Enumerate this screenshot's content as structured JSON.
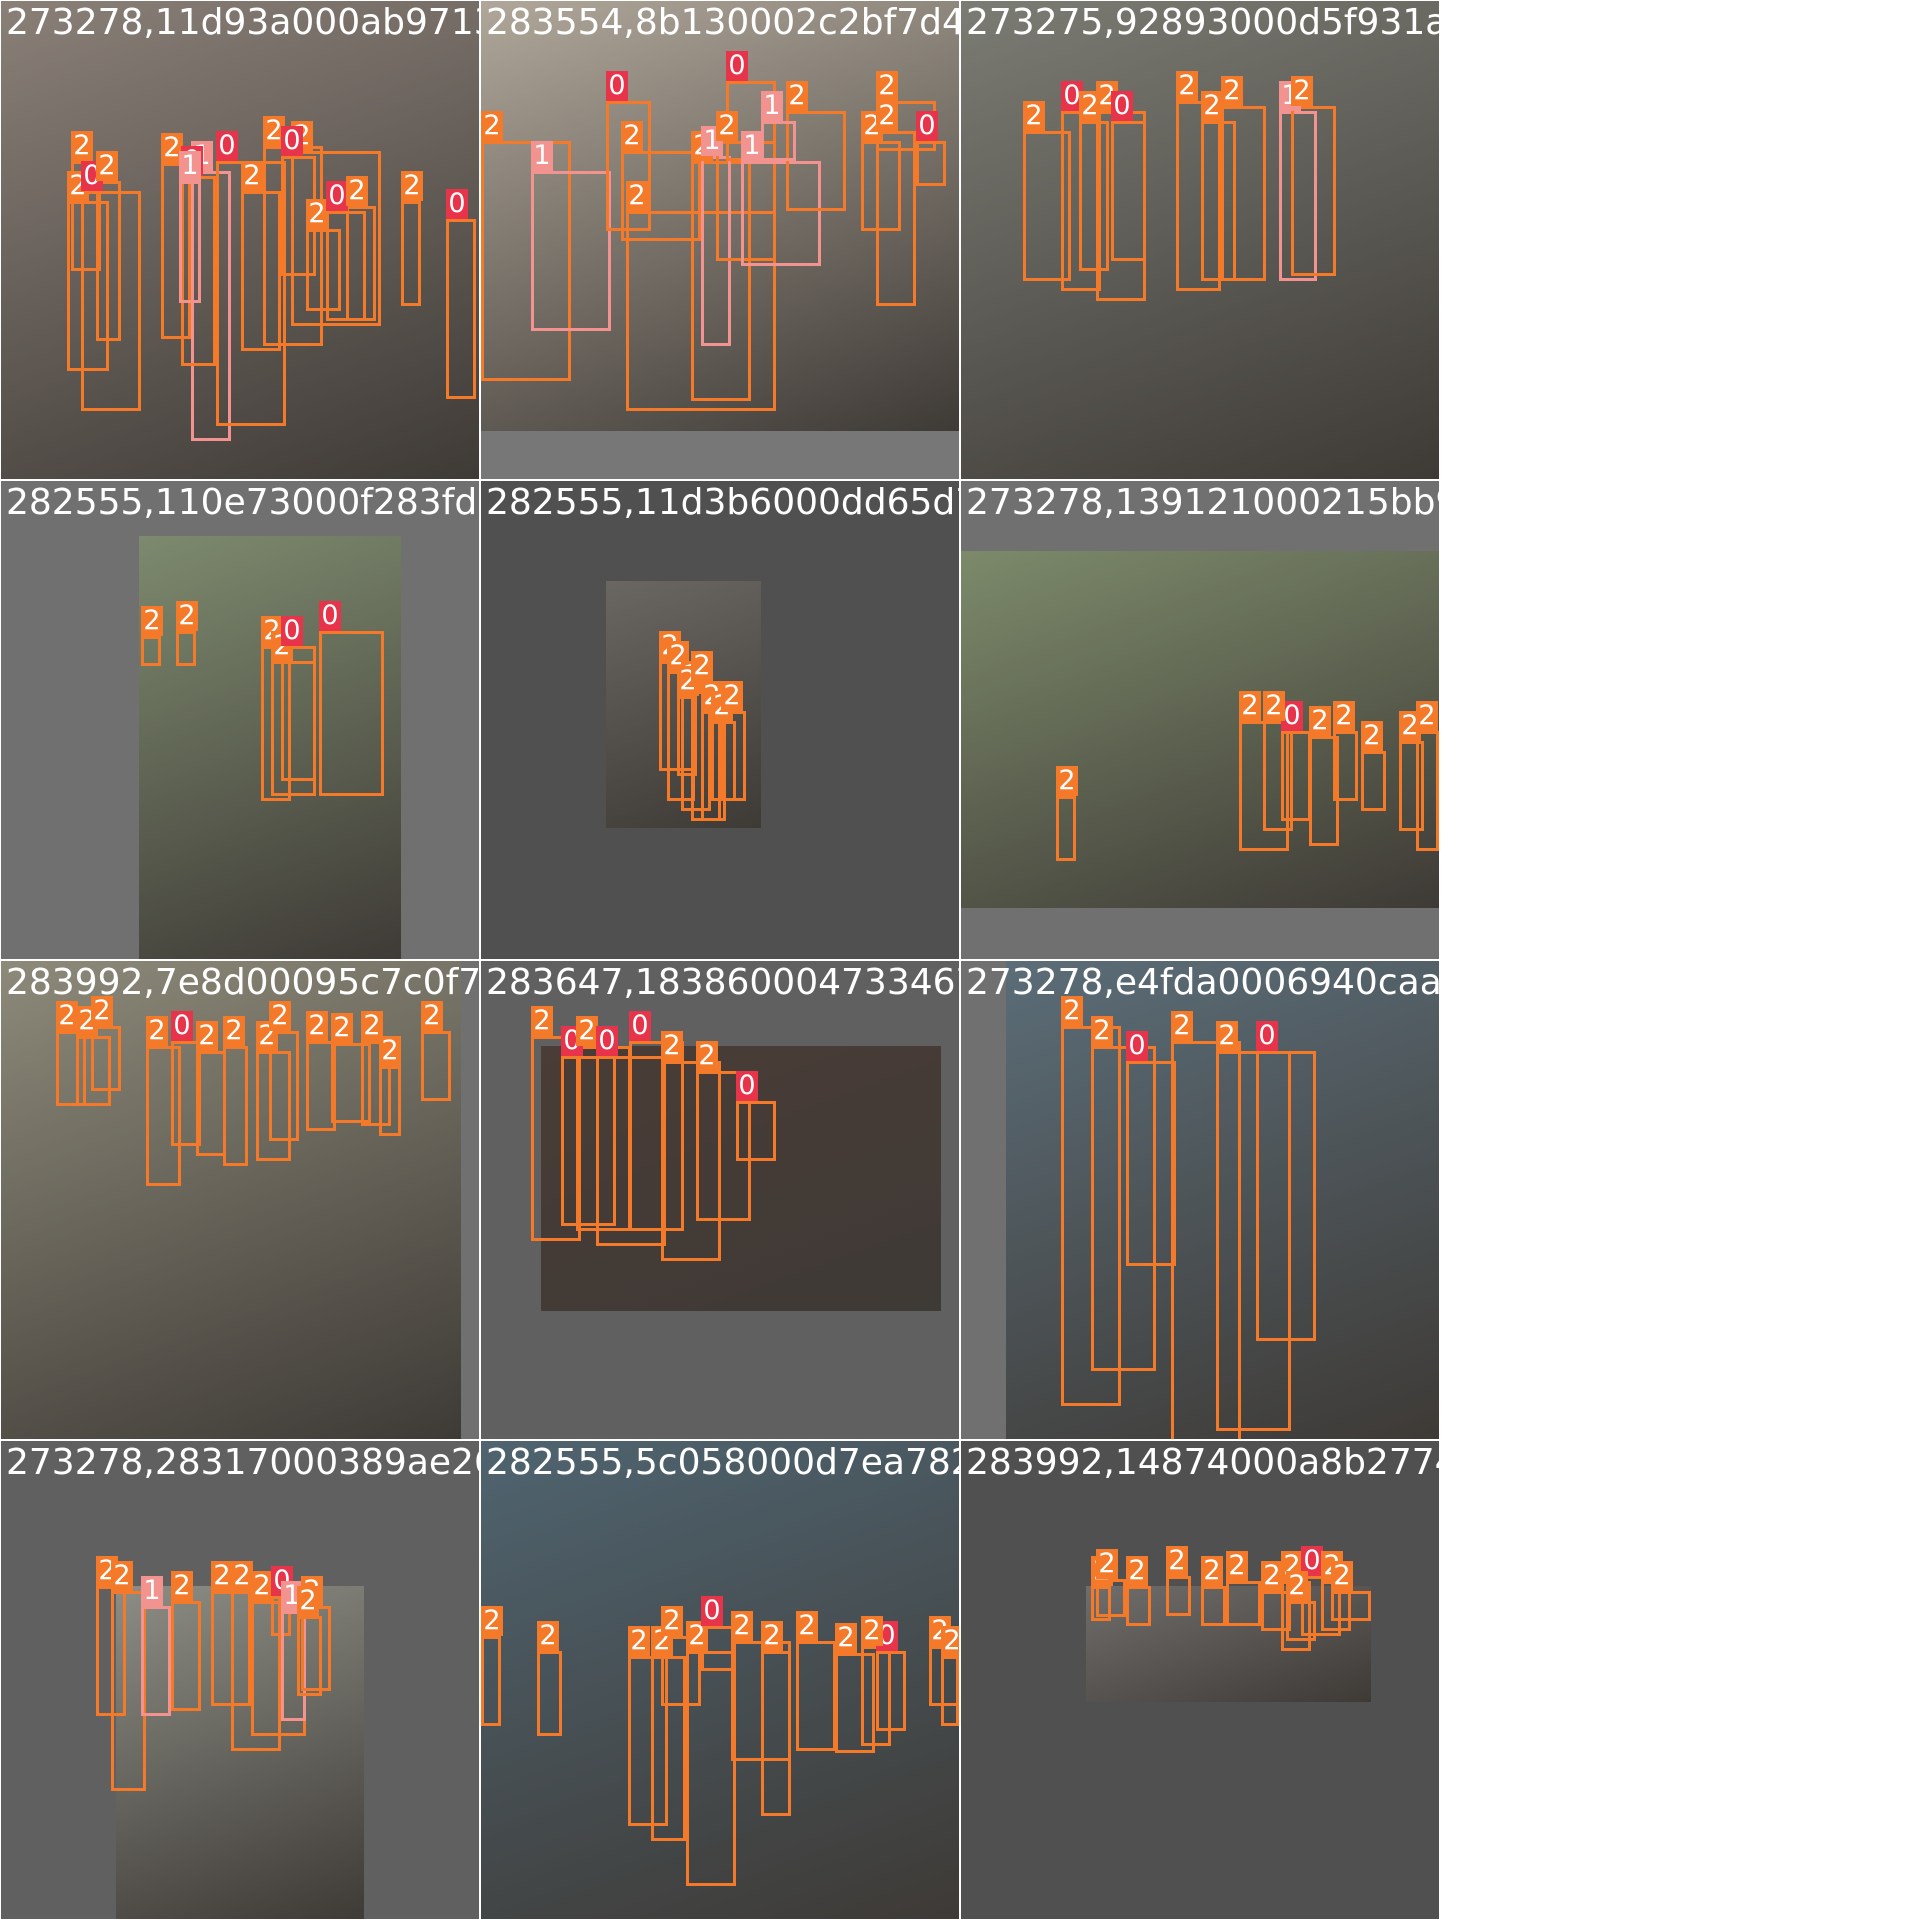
{
  "tiles": [
    {
      "filename": "273278,11d93a000ab97130.jpg",
      "photo_color": "#8a8078",
      "boxes": [
        {
          "c": "2",
          "label": "2"
        },
        {
          "c": "0",
          "label": "0"
        },
        {
          "c": "2",
          "label": "2"
        },
        {
          "c": "1",
          "label": "1"
        },
        {
          "c": "2",
          "label": "2"
        },
        {
          "c": "0",
          "label": "0"
        },
        {
          "c": "1",
          "label": "1"
        },
        {
          "c": "0",
          "label": "0"
        },
        {
          "c": "2",
          "label": "2"
        },
        {
          "c": "2",
          "label": "2"
        },
        {
          "c": "0",
          "label": "0"
        },
        {
          "c": "2",
          "label": "2"
        },
        {
          "c": "2",
          "label": "2"
        },
        {
          "c": "0",
          "label": "0"
        },
        {
          "c": "2",
          "label": "2"
        },
        {
          "c": "2",
          "label": "2"
        },
        {
          "c": "0",
          "label": "0"
        },
        {
          "c": "2",
          "label": "2"
        }
      ]
    },
    {
      "filename": "283554,8b130002c2bf7d4.jpg",
      "photo_color": "#b0a79a",
      "boxes": [
        {
          "c": "2",
          "label": "2"
        },
        {
          "c": "1",
          "label": "1"
        },
        {
          "c": "2",
          "label": "2"
        },
        {
          "c": "2",
          "label": "2"
        },
        {
          "c": "2",
          "label": "2"
        },
        {
          "c": "0",
          "label": "0"
        },
        {
          "c": "1",
          "label": "1"
        },
        {
          "c": "2",
          "label": "2"
        },
        {
          "c": "0",
          "label": "0"
        },
        {
          "c": "1",
          "label": "1"
        },
        {
          "c": "2",
          "label": "2"
        },
        {
          "c": "1",
          "label": "1"
        },
        {
          "c": "2",
          "label": "2"
        },
        {
          "c": "2",
          "label": "2"
        },
        {
          "c": "0",
          "label": "0"
        },
        {
          "c": "2",
          "label": "2"
        }
      ]
    },
    {
      "filename": "273275,92893000d5f931ab.jpg",
      "photo_color": "#7b7c74",
      "boxes": [
        {
          "c": "2",
          "label": "2"
        },
        {
          "c": "0",
          "label": "0"
        },
        {
          "c": "2",
          "label": "2"
        },
        {
          "c": "2",
          "label": "2"
        },
        {
          "c": "0",
          "label": "0"
        },
        {
          "c": "2",
          "label": "2"
        },
        {
          "c": "2",
          "label": "2"
        },
        {
          "c": "2",
          "label": "2"
        },
        {
          "c": "1",
          "label": "1"
        },
        {
          "c": "2",
          "label": "2"
        }
      ]
    },
    {
      "filename": "282555,110e73000f283fd7f.jpg",
      "photo_color": "#7d8a6e",
      "boxes": [
        {
          "c": "2",
          "label": "2"
        },
        {
          "c": "2",
          "label": "2"
        },
        {
          "c": "2",
          "label": "2"
        },
        {
          "c": "2",
          "label": "2"
        },
        {
          "c": "0",
          "label": "0"
        },
        {
          "c": "0",
          "label": "0"
        }
      ]
    },
    {
      "filename": "282555,11d3b6000dd65d7b6.jpg",
      "photo_color": "#6a6662",
      "boxes": [
        {
          "c": "2",
          "label": "2"
        },
        {
          "c": "2",
          "label": "2"
        },
        {
          "c": "2",
          "label": "2"
        },
        {
          "c": "2",
          "label": "2"
        },
        {
          "c": "2",
          "label": "2"
        },
        {
          "c": "2",
          "label": "2"
        },
        {
          "c": "2",
          "label": "2"
        },
        {
          "c": "2",
          "label": "2"
        }
      ]
    },
    {
      "filename": "273278,139121000215bb918.jpg",
      "photo_color": "#7c8a6a",
      "boxes": [
        {
          "c": "2",
          "label": "2"
        },
        {
          "c": "2",
          "label": "2"
        },
        {
          "c": "0",
          "label": "0"
        },
        {
          "c": "2",
          "label": "2"
        },
        {
          "c": "2",
          "label": "2"
        },
        {
          "c": "2",
          "label": "2"
        },
        {
          "c": "2",
          "label": "2"
        },
        {
          "c": "2",
          "label": "2"
        },
        {
          "c": "2",
          "label": "2"
        }
      ]
    },
    {
      "filename": "283992,7e8d00095c7c0f7.jpg",
      "photo_color": "#8d8a7a",
      "boxes": [
        {
          "c": "2",
          "label": "2"
        },
        {
          "c": "2",
          "label": "2"
        },
        {
          "c": "2",
          "label": "2"
        },
        {
          "c": "2",
          "label": "2"
        },
        {
          "c": "0",
          "label": "0"
        },
        {
          "c": "2",
          "label": "2"
        },
        {
          "c": "2",
          "label": "2"
        },
        {
          "c": "2",
          "label": "2"
        },
        {
          "c": "2",
          "label": "2"
        },
        {
          "c": "2",
          "label": "2"
        },
        {
          "c": "2",
          "label": "2"
        },
        {
          "c": "2",
          "label": "2"
        },
        {
          "c": "2",
          "label": "2"
        },
        {
          "c": "2",
          "label": "2"
        }
      ]
    },
    {
      "filename": "283647,1838600047334670.jpg",
      "photo_color": "#4a3c36",
      "boxes": [
        {
          "c": "2",
          "label": "2"
        },
        {
          "c": "0",
          "label": "0"
        },
        {
          "c": "2",
          "label": "2"
        },
        {
          "c": "0",
          "label": "0"
        },
        {
          "c": "0",
          "label": "0"
        },
        {
          "c": "2",
          "label": "2"
        },
        {
          "c": "2",
          "label": "2"
        },
        {
          "c": "0",
          "label": "0"
        }
      ]
    },
    {
      "filename": "273278,e4fda0006940caaf.jpg",
      "photo_color": "#5b6d78",
      "boxes": [
        {
          "c": "2",
          "label": "2"
        },
        {
          "c": "2",
          "label": "2"
        },
        {
          "c": "0",
          "label": "0"
        },
        {
          "c": "2",
          "label": "2"
        },
        {
          "c": "2",
          "label": "2"
        },
        {
          "c": "0",
          "label": "0"
        }
      ]
    },
    {
      "filename": "273278,28317000389ae26d.jpg",
      "photo_color": "#8c8d84",
      "boxes": [
        {
          "c": "2",
          "label": "2"
        },
        {
          "c": "2",
          "label": "2"
        },
        {
          "c": "1",
          "label": "1"
        },
        {
          "c": "2",
          "label": "2"
        },
        {
          "c": "2",
          "label": "2"
        },
        {
          "c": "2",
          "label": "2"
        },
        {
          "c": "2",
          "label": "2"
        },
        {
          "c": "0",
          "label": "0"
        },
        {
          "c": "1",
          "label": "1"
        },
        {
          "c": "2",
          "label": "2"
        },
        {
          "c": "2",
          "label": "2"
        }
      ]
    },
    {
      "filename": "282555,5c058000d7ea7821.jpg",
      "photo_color": "#4f6470",
      "boxes": [
        {
          "c": "2",
          "label": "2"
        },
        {
          "c": "2",
          "label": "2"
        },
        {
          "c": "2",
          "label": "2"
        },
        {
          "c": "2",
          "label": "2"
        },
        {
          "c": "2",
          "label": "2"
        },
        {
          "c": "0",
          "label": "0"
        },
        {
          "c": "2",
          "label": "2"
        },
        {
          "c": "2",
          "label": "2"
        },
        {
          "c": "2",
          "label": "2"
        },
        {
          "c": "0",
          "label": "0"
        },
        {
          "c": "2",
          "label": "2"
        },
        {
          "c": "2",
          "label": "2"
        },
        {
          "c": "2",
          "label": "2"
        },
        {
          "c": "2",
          "label": "2"
        },
        {
          "c": "2",
          "label": "2"
        }
      ]
    },
    {
      "filename": "283992,14874000a8b27747.jpg",
      "photo_color": "#706e6c",
      "boxes": [
        {
          "c": "2",
          "label": "2"
        },
        {
          "c": "2",
          "label": "2"
        },
        {
          "c": "2",
          "label": "2"
        },
        {
          "c": "2",
          "label": "2"
        },
        {
          "c": "2",
          "label": "2"
        },
        {
          "c": "2",
          "label": "2"
        },
        {
          "c": "2",
          "label": "2"
        },
        {
          "c": "0",
          "label": "0"
        },
        {
          "c": "2",
          "label": "2"
        },
        {
          "c": "2",
          "label": "2"
        },
        {
          "c": "2",
          "label": "2"
        },
        {
          "c": "2",
          "label": "2"
        }
      ]
    }
  ]
}
